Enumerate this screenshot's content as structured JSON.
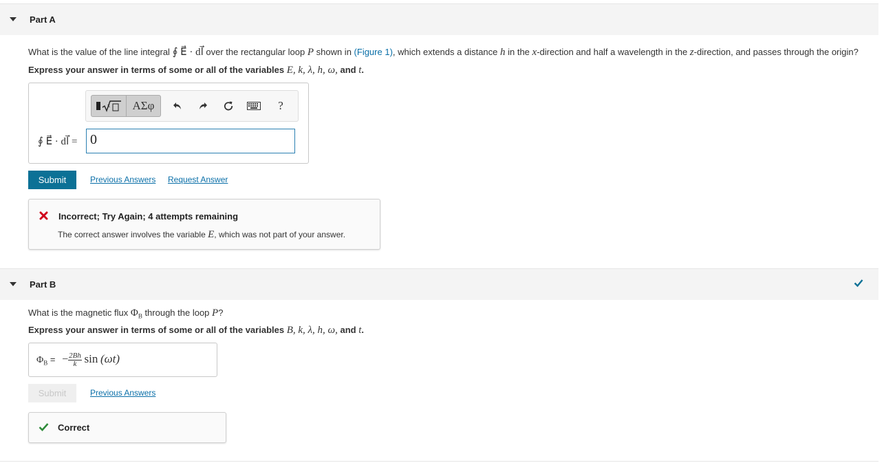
{
  "partA": {
    "header": "Part A",
    "question": {
      "before": "What is the value of the line integral ",
      "integral": "∮ E⃗ · dl⃗",
      "mid1": " over the rectangular loop ",
      "loop": "P",
      "mid2": " shown in ",
      "figure_link": "(Figure 1)",
      "mid3": ", which extends a distance ",
      "h": "h",
      "mid4": " in the ",
      "x": "x",
      "mid5": "-direction and half a wavelength in the ",
      "z": "z",
      "mid6": "-direction, and passes through the origin?"
    },
    "instruction": {
      "text": "Express your answer in terms of some or all of the variables ",
      "vars": "E, k, λ, h, ω,",
      "and": " and ",
      "last": "t",
      "end": "."
    },
    "toolbar": {
      "template_icon": "template-sqrt-icon",
      "greek_label": "ΑΣφ",
      "undo_icon": "undo-icon",
      "redo_icon": "redo-icon",
      "reset_icon": "reset-icon",
      "keyboard_icon": "keyboard-icon",
      "help_label": "?"
    },
    "equation_label": "∮ E⃗ · dl⃗ =",
    "answer_value": "0",
    "submit_label": "Submit",
    "previous_answers_label": "Previous Answers",
    "request_answer_label": "Request Answer",
    "feedback": {
      "status": "incorrect",
      "title": "Incorrect; Try Again; 4 attempts remaining",
      "body_before": "The correct answer involves the variable ",
      "body_var": "E",
      "body_after": ", which was not part of your answer."
    }
  },
  "partB": {
    "header": "Part B",
    "completed": true,
    "question": {
      "before": "What is the magnetic flux ",
      "phi": "Φ",
      "phi_sub": "B",
      "mid": " through the loop ",
      "loop": "P",
      "end": "?"
    },
    "instruction": {
      "text": "Express your answer in terms of some or all of the variables ",
      "vars": "B, k, λ, h, ω,",
      "and": " and ",
      "last": "t",
      "end": "."
    },
    "answer": {
      "label_phi": "Φ",
      "label_sub": "B",
      "label_eq": " =",
      "sign": "−",
      "frac_num": "2Bh",
      "frac_den": "k",
      "func": "sin",
      "arg": "(ωt)"
    },
    "submit_label": "Submit",
    "previous_answers_label": "Previous Answers",
    "feedback": {
      "status": "correct",
      "title": "Correct"
    }
  },
  "colors": {
    "accent_blue": "#0c7196",
    "link_blue": "#0a6fa8",
    "error_red": "#d0021b",
    "success_green": "#2e8b3a"
  }
}
